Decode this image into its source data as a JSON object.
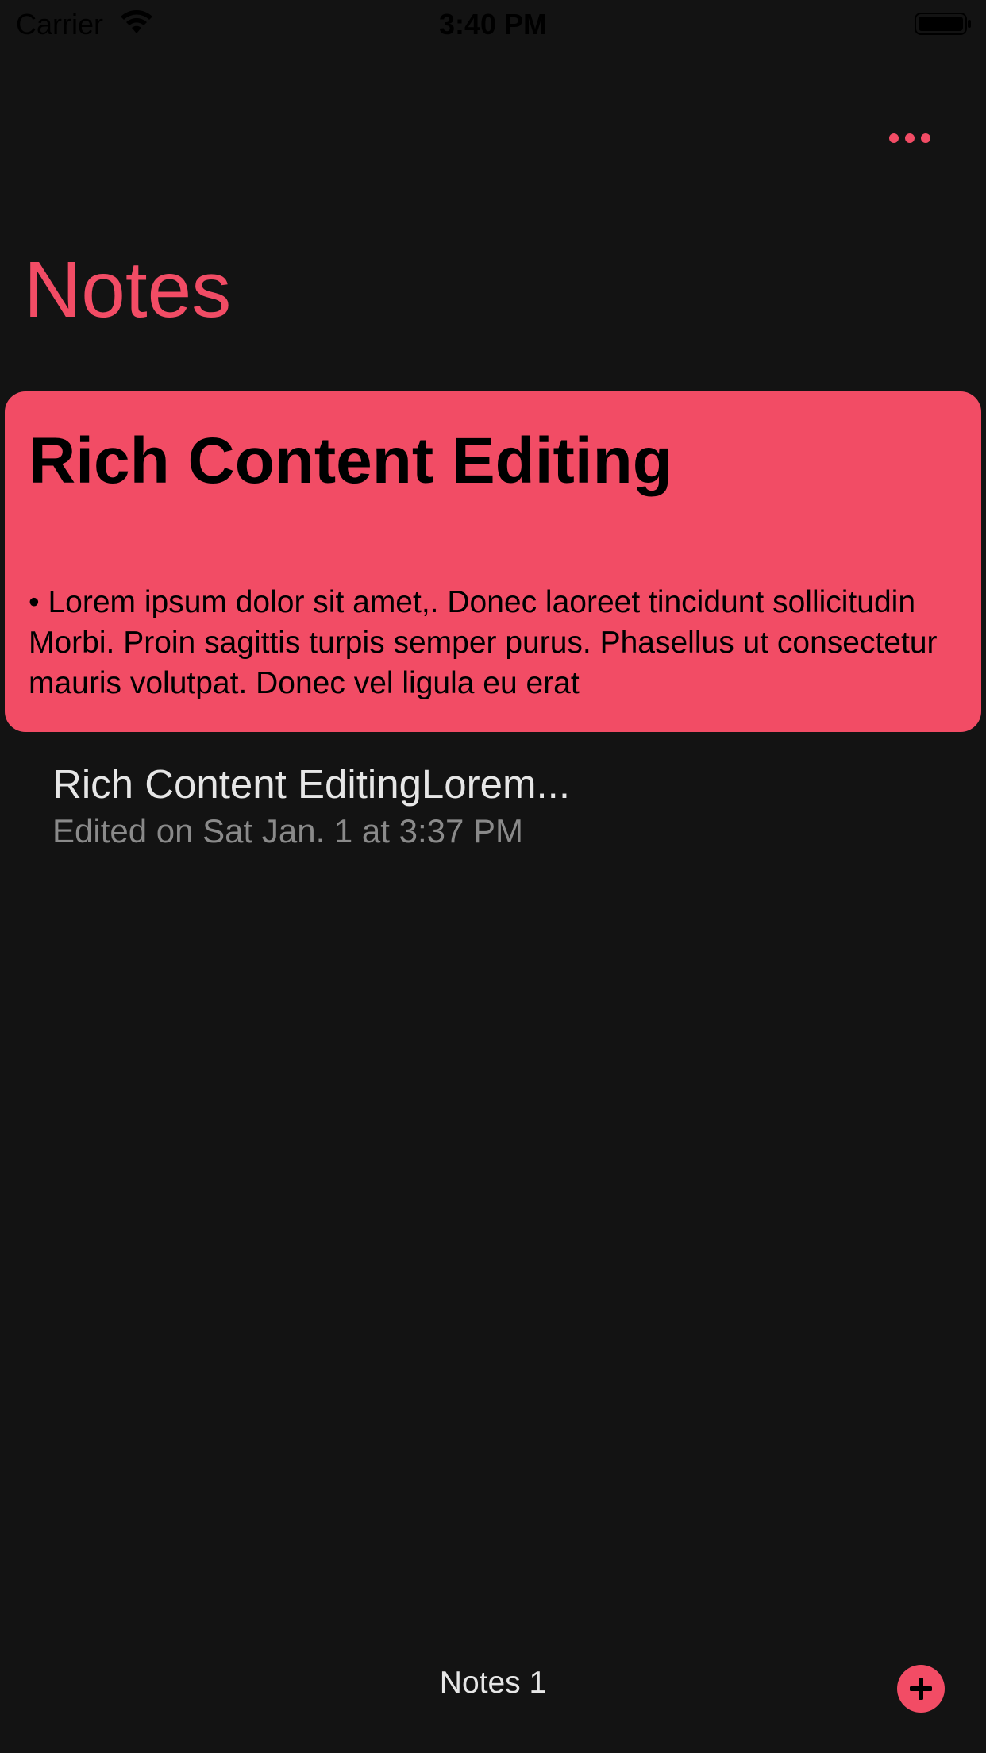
{
  "status_bar": {
    "carrier": "Carrier",
    "time": "3:40 PM"
  },
  "header": {
    "title": "Notes",
    "more_icon": "ellipsis-icon"
  },
  "preview": {
    "title": "Rich Content Editing",
    "body": "• Lorem ipsum dolor sit amet,. Donec laoreet tincidunt sollicitudin Morbi. Proin sagittis turpis semper purus. Phasellus ut consectetur mauris volutpat. Donec vel ligula eu erat"
  },
  "notes": [
    {
      "title": "Rich Content EditingLorem...",
      "subtitle": "Edited on Sat Jan. 1 at 3:37 PM"
    }
  ],
  "toolbar": {
    "count_label": "Notes 1",
    "add_icon": "plus-circle-icon"
  },
  "colors": {
    "accent": "#f24c65",
    "background": "#131313",
    "primary_text": "#e6e6e6",
    "secondary_text": "#8a8a8a"
  }
}
